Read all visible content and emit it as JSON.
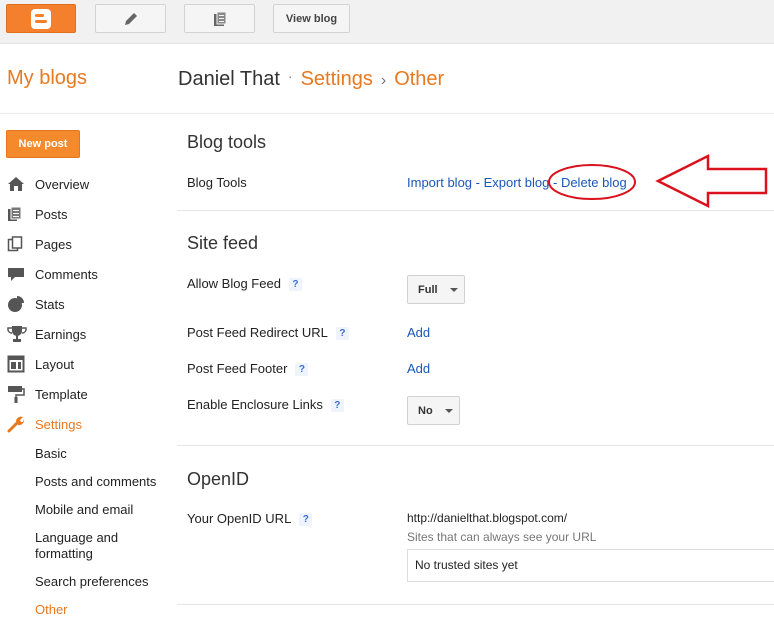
{
  "toolbar": {
    "view_blog": "View blog"
  },
  "header": {
    "my_blogs": "My blogs",
    "blog_name": "Daniel That",
    "separator": "·",
    "crumb_sep": "›",
    "settings": "Settings",
    "page": "Other"
  },
  "sidebar": {
    "new_post": "New post",
    "items": [
      {
        "label": "Overview",
        "icon": "home-icon"
      },
      {
        "label": "Posts",
        "icon": "posts-icon"
      },
      {
        "label": "Pages",
        "icon": "pages-icon"
      },
      {
        "label": "Comments",
        "icon": "comment-icon"
      },
      {
        "label": "Stats",
        "icon": "pie-chart-icon"
      },
      {
        "label": "Earnings",
        "icon": "trophy-icon"
      },
      {
        "label": "Layout",
        "icon": "layout-icon"
      },
      {
        "label": "Template",
        "icon": "paint-roller-icon"
      },
      {
        "label": "Settings",
        "icon": "wrench-icon",
        "active": true
      }
    ],
    "sub_items": [
      {
        "label": "Basic"
      },
      {
        "label": "Posts and comments"
      },
      {
        "label": "Mobile and email"
      },
      {
        "label": "Language and formatting"
      },
      {
        "label": "Search preferences"
      },
      {
        "label": "Other",
        "active": true
      }
    ]
  },
  "blog_tools": {
    "title": "Blog tools",
    "label": "Blog Tools",
    "import": "Import blog",
    "dash1": " - ",
    "export": "Export blog",
    "dash2": " - ",
    "delete": "Delete blog"
  },
  "site_feed": {
    "title": "Site feed",
    "allow_label": "Allow Blog Feed",
    "allow_value": "Full",
    "redirect_label": "Post Feed Redirect URL",
    "redirect_action": "Add",
    "footer_label": "Post Feed Footer",
    "footer_action": "Add",
    "enclosure_label": "Enable Enclosure Links",
    "enclosure_value": "No",
    "help": "?"
  },
  "openid": {
    "title": "OpenID",
    "label": "Your OpenID URL",
    "url": "http://danielthat.blogspot.com/",
    "note": "Sites that can always see your URL",
    "trusted": "No trusted sites yet"
  },
  "colors": {
    "accent": "#e8791f",
    "link": "#1a57b8",
    "annotation_red": "#d9121c"
  }
}
